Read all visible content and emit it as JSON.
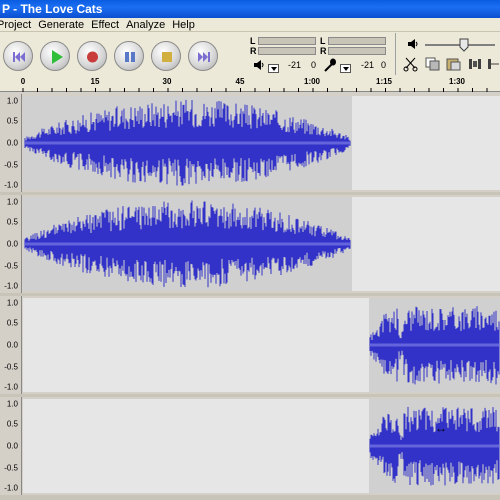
{
  "window": {
    "title": "P - The Love Cats"
  },
  "menu": [
    "Project",
    "Generate",
    "Effect",
    "Analyze",
    "Help"
  ],
  "toolbar": {
    "buttons": [
      {
        "name": "skip-start-button",
        "icon": "skip-start-icon"
      },
      {
        "name": "play-button",
        "icon": "play-icon"
      },
      {
        "name": "record-button",
        "icon": "record-icon"
      },
      {
        "name": "pause-button",
        "icon": "pause-icon"
      },
      {
        "name": "stop-button",
        "icon": "stop-icon"
      },
      {
        "name": "skip-end-button",
        "icon": "skip-end-icon"
      }
    ],
    "playback_meter": {
      "left": "L",
      "right": "R",
      "mark": "-21",
      "level": "0"
    },
    "record_meter": {
      "left": "L",
      "right": "R",
      "mark": "-21",
      "level": "0"
    }
  },
  "ruler": {
    "ticks": [
      "0",
      "15",
      "30",
      "45",
      "1:00",
      "1:15",
      "1:30"
    ]
  },
  "tracks": [
    {
      "name": "track-1-left",
      "yticks": [
        "1.0",
        "0.5",
        "0.0",
        "-0.5",
        "-1.0"
      ]
    },
    {
      "name": "track-1-right",
      "yticks": [
        "1.0",
        "0.5",
        "0.0",
        "-0.5",
        "-1.0"
      ]
    },
    {
      "name": "track-2-left",
      "yticks": [
        "1.0",
        "0.5",
        "0.0",
        "-0.5",
        "-1.0"
      ]
    },
    {
      "name": "track-2-right",
      "yticks": [
        "1.0",
        "0.5",
        "0.0",
        "-0.5",
        "-1.0"
      ]
    }
  ],
  "colors": {
    "waveform": "#3232c8",
    "waveform_light": "#6464dc",
    "titlebar": "#0a5ce0",
    "selected_clip": "#d0d0d0"
  }
}
